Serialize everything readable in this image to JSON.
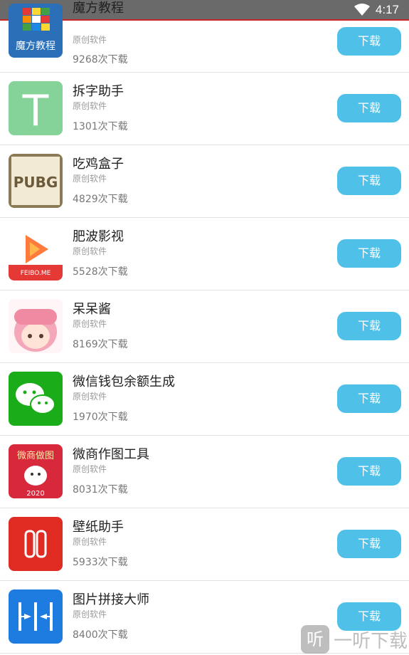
{
  "status_bar": {
    "time": "4:17",
    "wifi_icon": "wifi-icon"
  },
  "apps": [
    {
      "name": "魔方教程",
      "subtitle": "原创软件",
      "downloads": "9268次下载",
      "button": "下载",
      "icon": "rubiks-cube-icon",
      "icon_text": "魔方教程"
    },
    {
      "name": "拆字助手",
      "subtitle": "原创软件",
      "downloads": "1301次下载",
      "button": "下载",
      "icon": "letter-t-icon",
      "icon_text": "T"
    },
    {
      "name": "吃鸡盒子",
      "subtitle": "原创软件",
      "downloads": "4829次下载",
      "button": "下载",
      "icon": "pubg-icon",
      "icon_text": "PUBG"
    },
    {
      "name": "肥波影视",
      "subtitle": "原创软件",
      "downloads": "5528次下载",
      "button": "下载",
      "icon": "play-icon",
      "icon_text": "FEIBO.ME"
    },
    {
      "name": "呆呆酱",
      "subtitle": "原创软件",
      "downloads": "8169次下载",
      "button": "下载",
      "icon": "anime-girl-icon"
    },
    {
      "name": "微信钱包余额生成",
      "subtitle": "原创软件",
      "downloads": "1970次下载",
      "button": "下载",
      "icon": "wechat-icon"
    },
    {
      "name": "微商作图工具",
      "subtitle": "原创软件",
      "downloads": "8031次下载",
      "button": "下载",
      "icon": "lucky-cat-icon",
      "icon_text": "微商做图",
      "icon_year": "2020"
    },
    {
      "name": "壁纸助手",
      "subtitle": "原创软件",
      "downloads": "5933次下载",
      "button": "下载",
      "icon": "wallpaper-icon"
    },
    {
      "name": "图片拼接大师",
      "subtitle": "原创软件",
      "downloads": "8400次下载",
      "button": "下载",
      "icon": "image-join-icon"
    }
  ],
  "watermark": {
    "icon_glyph": "听",
    "text": "一听下载"
  },
  "colors": {
    "button": "#4fc0e8",
    "status_bar": "#6a6a6a"
  }
}
